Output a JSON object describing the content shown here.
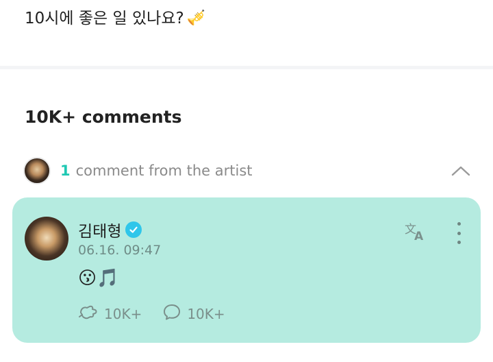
{
  "post": {
    "text": "10시에 좋은 일 있나요?",
    "trailing_icon": "trumpet-icon",
    "trailing_emoji": "🎺"
  },
  "comments": {
    "title": "10K+ comments",
    "artist_count": "1",
    "artist_label": "comment from the artist",
    "artist_comment": {
      "author": "김태형",
      "verified": true,
      "timestamp": "06.16. 09:47",
      "body": "😗🎵",
      "cheer_count": "10K+",
      "reply_count": "10K+"
    }
  },
  "colors": {
    "accent": "#1fc8b3",
    "card_background": "#b5ebe0",
    "verified_badge": "#2fc6ea"
  },
  "icons": {
    "collapse": "chevron-up-icon",
    "translate": "translate-icon",
    "more": "more-vertical-icon",
    "cheer": "cheer-icon",
    "reply": "speech-bubble-icon"
  }
}
